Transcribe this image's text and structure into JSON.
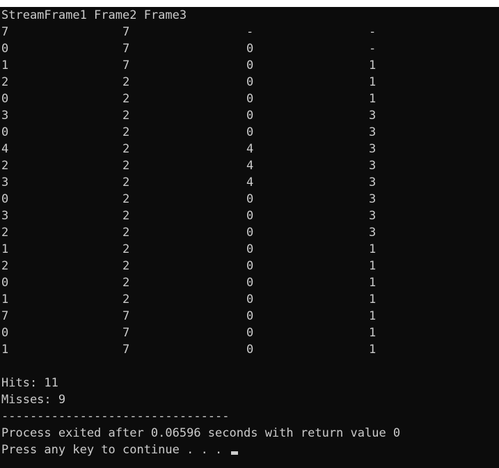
{
  "console": {
    "header": "StreamFrame1 Frame2 Frame3",
    "rows": [
      [
        "7",
        "7",
        "-",
        "-"
      ],
      [
        "0",
        "7",
        "0",
        "-"
      ],
      [
        "1",
        "7",
        "0",
        "1"
      ],
      [
        "2",
        "2",
        "0",
        "1"
      ],
      [
        "0",
        "2",
        "0",
        "1"
      ],
      [
        "3",
        "2",
        "0",
        "3"
      ],
      [
        "0",
        "2",
        "0",
        "3"
      ],
      [
        "4",
        "2",
        "4",
        "3"
      ],
      [
        "2",
        "2",
        "4",
        "3"
      ],
      [
        "3",
        "2",
        "4",
        "3"
      ],
      [
        "0",
        "2",
        "0",
        "3"
      ],
      [
        "3",
        "2",
        "0",
        "3"
      ],
      [
        "2",
        "2",
        "0",
        "3"
      ],
      [
        "1",
        "2",
        "0",
        "1"
      ],
      [
        "2",
        "2",
        "0",
        "1"
      ],
      [
        "0",
        "2",
        "0",
        "1"
      ],
      [
        "1",
        "2",
        "0",
        "1"
      ],
      [
        "7",
        "7",
        "0",
        "1"
      ],
      [
        "0",
        "7",
        "0",
        "1"
      ],
      [
        "1",
        "7",
        "0",
        "1"
      ]
    ],
    "hits": "Hits: 11",
    "misses": "Misses: 9",
    "separator": "--------------------------------",
    "exit_message": "Process exited after 0.06596 seconds with return value 0",
    "prompt": "Press any key to continue . . . "
  }
}
